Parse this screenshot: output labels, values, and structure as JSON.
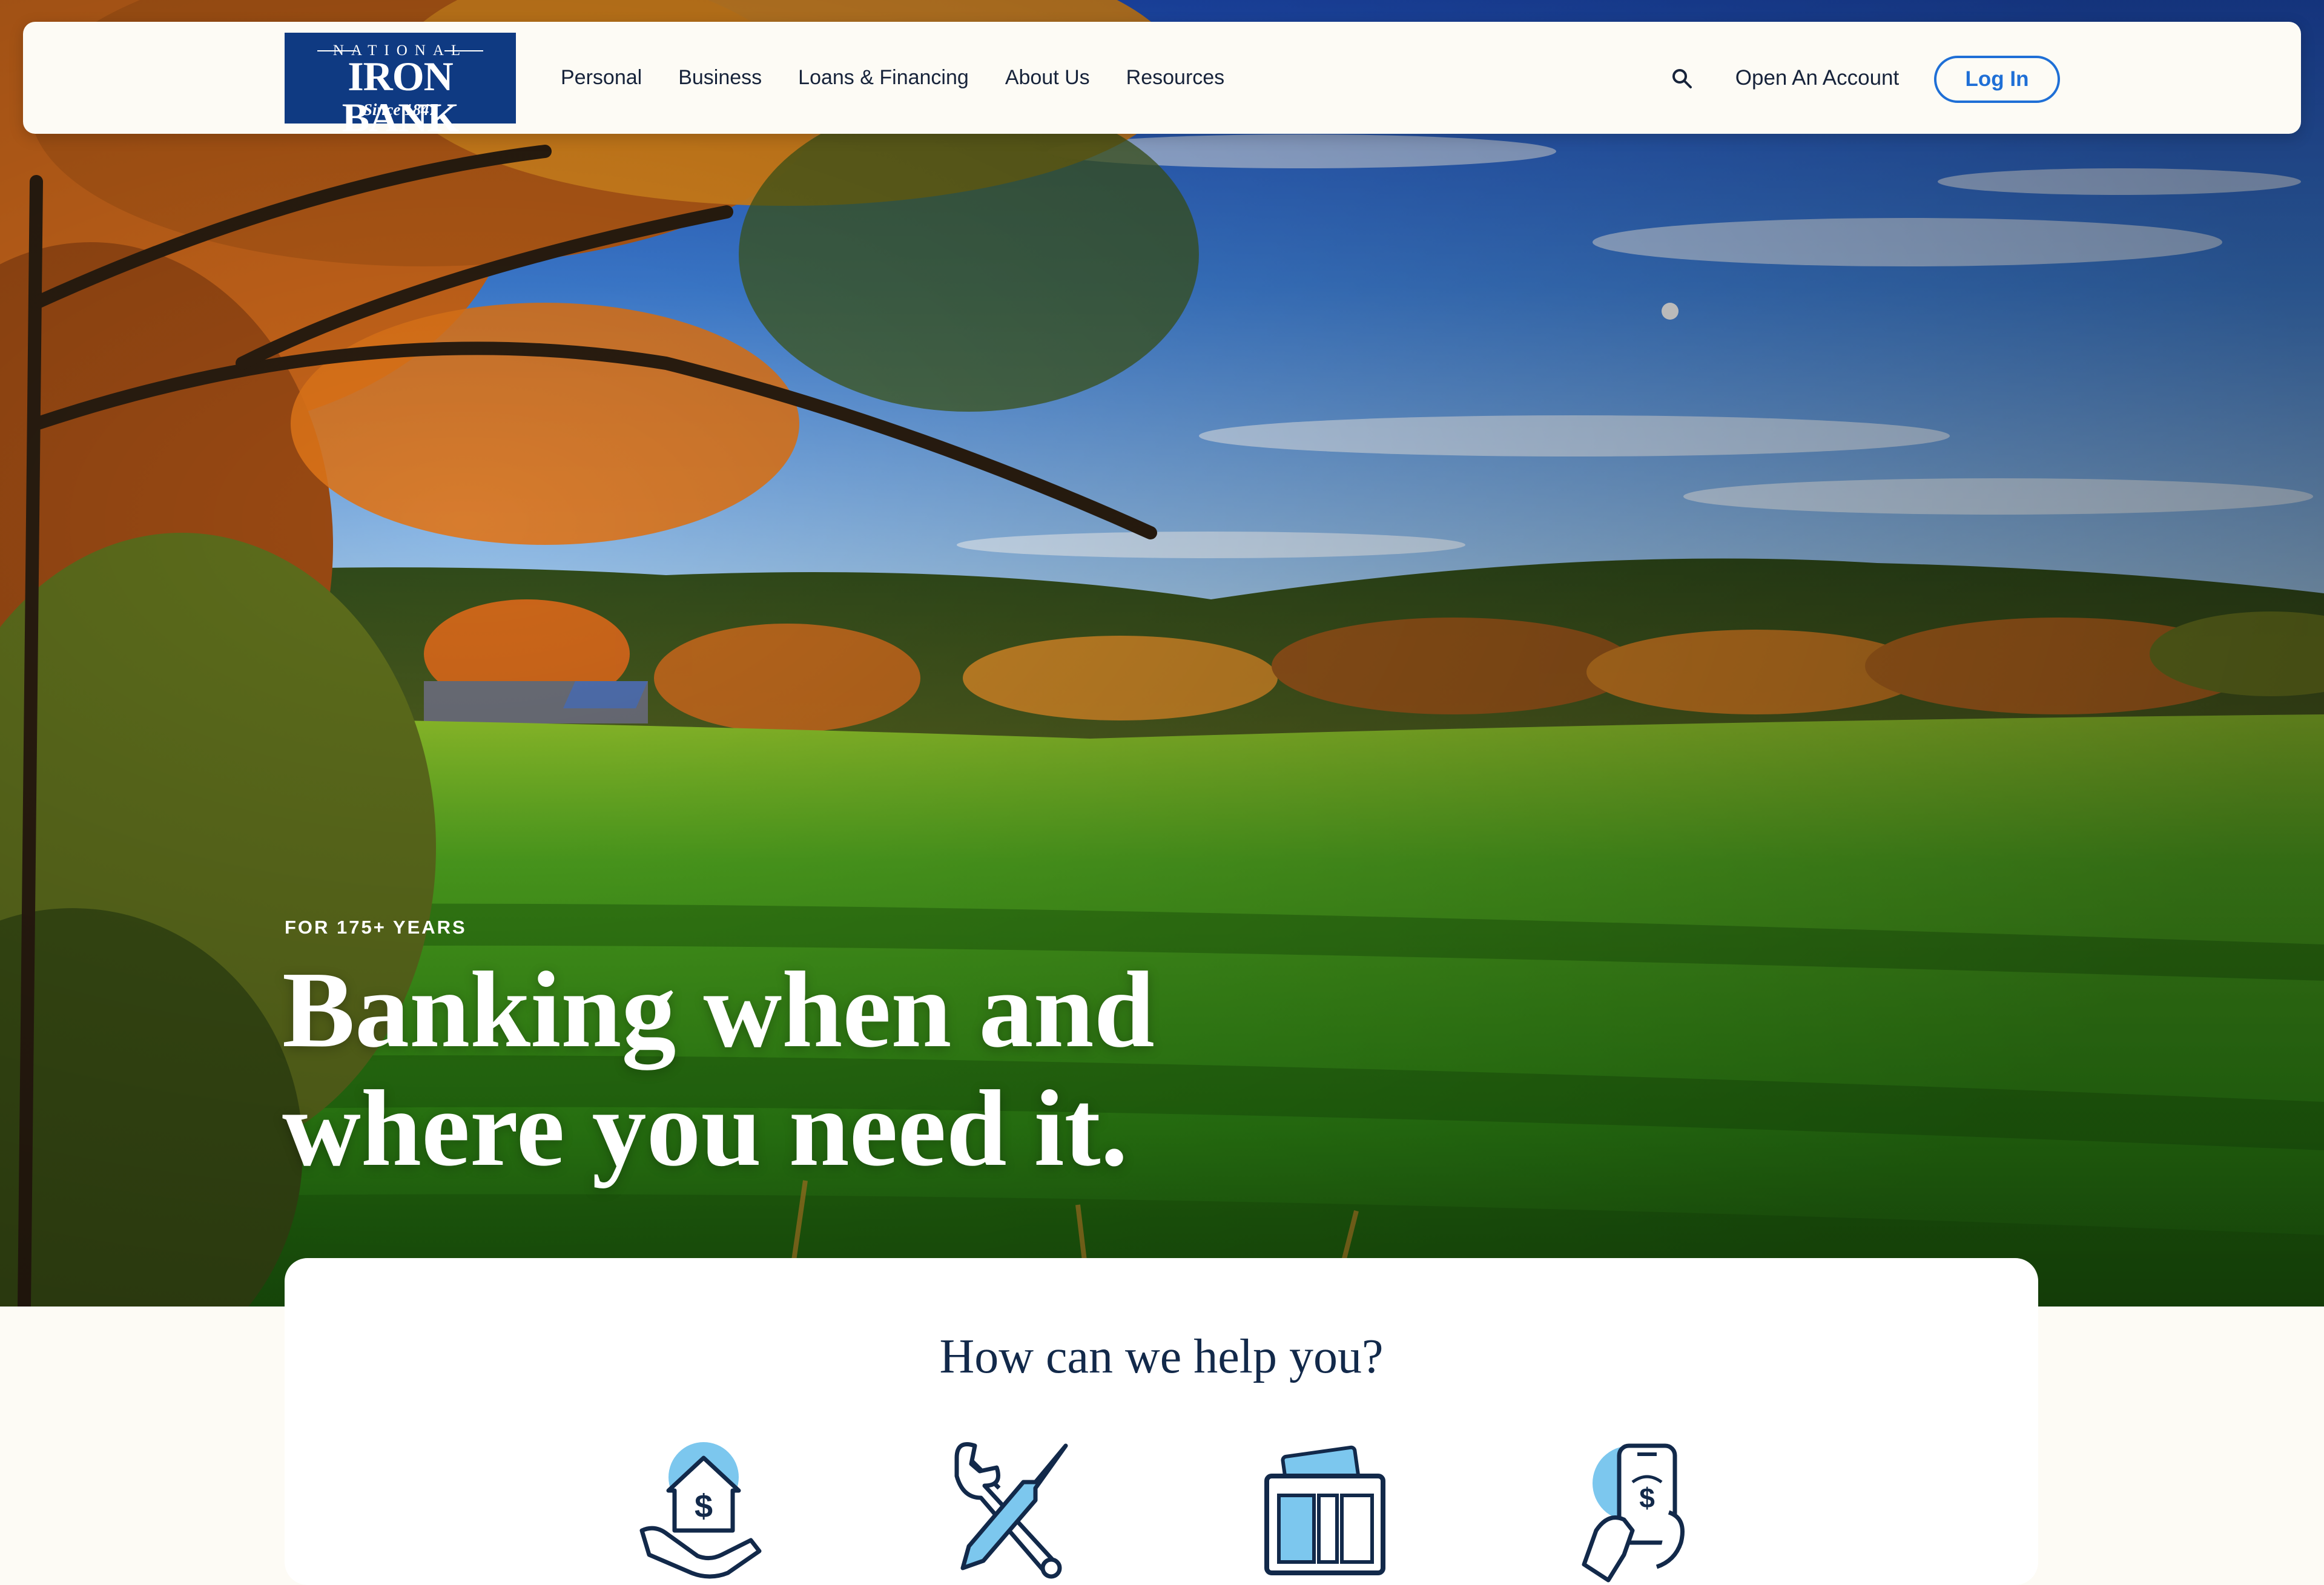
{
  "logo": {
    "line1": "NATIONAL",
    "line2": "IRON BANK",
    "line3": "Since 1847",
    "color": "#0f3a82"
  },
  "nav": {
    "items": [
      {
        "label": "Personal"
      },
      {
        "label": "Business"
      },
      {
        "label": "Loans & Financing"
      },
      {
        "label": "About Us"
      },
      {
        "label": "Resources"
      }
    ],
    "search_icon": "search-icon",
    "open_account": "Open An Account",
    "login": "Log In"
  },
  "hero": {
    "eyebrow": "FOR 175+ YEARS",
    "headline_line1": "Banking when and",
    "headline_line2": "where you need it."
  },
  "help": {
    "title": "How can we help you?",
    "icons": [
      "house-dollar-hand-icon",
      "wrench-screwdriver-icon",
      "wallet-cards-icon",
      "phone-dollar-hand-icon"
    ]
  },
  "colors": {
    "brand_navy": "#0f3a82",
    "accent_blue": "#1f6fd6",
    "icon_light_blue": "#7cc7ee",
    "ink": "#17233a",
    "cream": "#fdfbf5"
  }
}
